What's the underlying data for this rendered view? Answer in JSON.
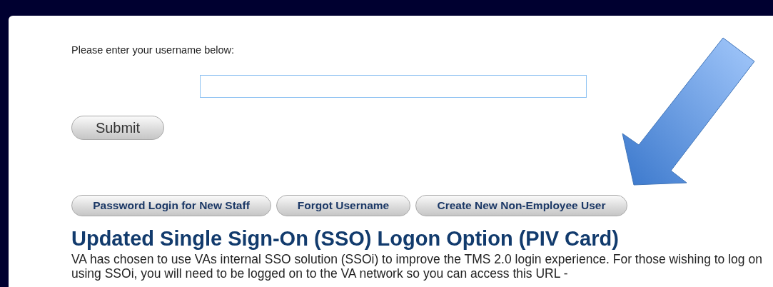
{
  "prompt": "Please enter your username below:",
  "submit_button": "Submit",
  "link_buttons": [
    "Password Login for New Staff",
    "Forgot Username",
    "Create New Non-Employee User"
  ],
  "heading": "Updated Single Sign-On (SSO) Logon Option (PIV Card)",
  "paragraph": "VA has chosen to use VAs internal SSO solution (SSOi) to improve the TMS 2.0 login experience. For those wishing to log on using SSOi, you will need to be logged on to the VA network so you can access this URL -"
}
